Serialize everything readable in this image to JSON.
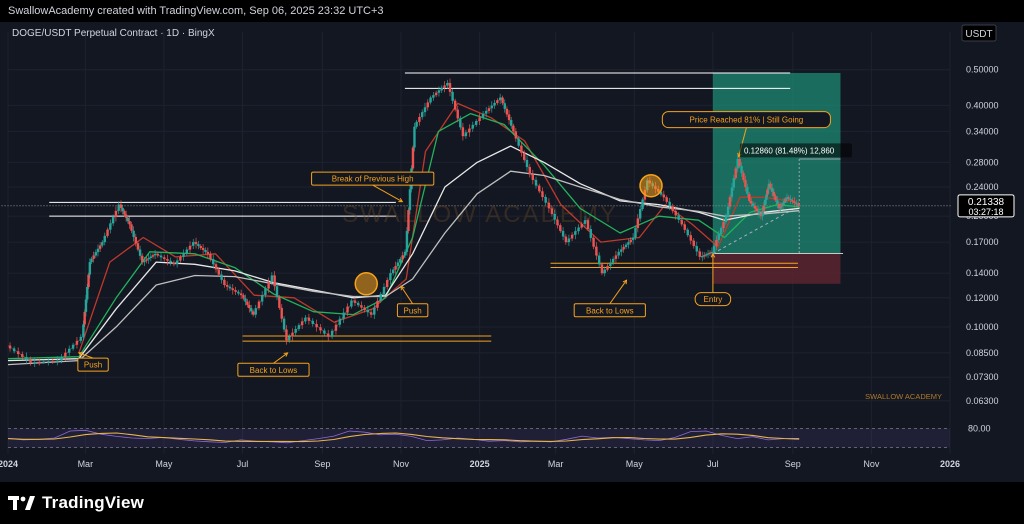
{
  "header": {
    "attribution": "SwallowAcademy created with TradingView.com, Sep 06, 2025 23:32 UTC+3"
  },
  "chart_title": "DOGE/USDT Perpetual Contract · 1D · BingX",
  "currency": "USDT",
  "watermark": "SWALLOW ACADEMY",
  "brand_tag": "SWALLOW ACADEMY",
  "footer": {
    "logo_text": "TradingView"
  },
  "colors": {
    "background": "#131722",
    "up": "#26a69a",
    "down": "#ef5350",
    "annotation": "#f7a21b",
    "profit_zone": "#1d8f76",
    "loss_zone": "#5c2530",
    "ma_fast": "#c0392b",
    "ma_mid": "#21b35a",
    "ma_slow": "#ffffff",
    "rsi": "#e8b54a",
    "rsi_band": "#7e57c2"
  },
  "chart_data": {
    "type": "line",
    "title": "DOGE/USDT Perpetual Contract · 1D · BingX",
    "yscale": "log",
    "ylim": [
      0.058,
      0.58
    ],
    "x_range": [
      "2024-01-01",
      "2026-01-01"
    ],
    "y_ticks": [
      "0.50000",
      "0.40000",
      "0.34000",
      "0.28000",
      "0.24000",
      "0.20000",
      "0.17000",
      "0.14000",
      "0.12000",
      "0.10000",
      "0.08500",
      "0.07300",
      "0.06300"
    ],
    "x_ticks": [
      {
        "label": "2024",
        "x": "2024-01-01"
      },
      {
        "label": "Mar",
        "x": "2024-03-01"
      },
      {
        "label": "May",
        "x": "2024-05-01"
      },
      {
        "label": "Jul",
        "x": "2024-07-01"
      },
      {
        "label": "Sep",
        "x": "2024-09-01"
      },
      {
        "label": "Nov",
        "x": "2024-11-01"
      },
      {
        "label": "2025",
        "x": "2025-01-01"
      },
      {
        "label": "Mar",
        "x": "2025-03-01"
      },
      {
        "label": "May",
        "x": "2025-05-01"
      },
      {
        "label": "Jul",
        "x": "2025-07-01"
      },
      {
        "label": "Sep",
        "x": "2025-09-01"
      },
      {
        "label": "Nov",
        "x": "2025-11-01"
      },
      {
        "label": "2026",
        "x": "2026-01-01"
      }
    ],
    "price_series": [
      {
        "x": "2024-01-01",
        "y": 0.089
      },
      {
        "x": "2024-01-20",
        "y": 0.08
      },
      {
        "x": "2024-02-10",
        "y": 0.081
      },
      {
        "x": "2024-02-28",
        "y": 0.094
      },
      {
        "x": "2024-03-05",
        "y": 0.15
      },
      {
        "x": "2024-03-15",
        "y": 0.17
      },
      {
        "x": "2024-03-28",
        "y": 0.215
      },
      {
        "x": "2024-04-05",
        "y": 0.19
      },
      {
        "x": "2024-04-15",
        "y": 0.15
      },
      {
        "x": "2024-04-25",
        "y": 0.158
      },
      {
        "x": "2024-05-10",
        "y": 0.148
      },
      {
        "x": "2024-05-25",
        "y": 0.17
      },
      {
        "x": "2024-06-05",
        "y": 0.158
      },
      {
        "x": "2024-06-18",
        "y": 0.13
      },
      {
        "x": "2024-07-01",
        "y": 0.122
      },
      {
        "x": "2024-07-10",
        "y": 0.108
      },
      {
        "x": "2024-07-25",
        "y": 0.138
      },
      {
        "x": "2024-08-05",
        "y": 0.092
      },
      {
        "x": "2024-08-20",
        "y": 0.106
      },
      {
        "x": "2024-09-07",
        "y": 0.094
      },
      {
        "x": "2024-09-25",
        "y": 0.118
      },
      {
        "x": "2024-10-10",
        "y": 0.108
      },
      {
        "x": "2024-10-25",
        "y": 0.14
      },
      {
        "x": "2024-11-05",
        "y": 0.16
      },
      {
        "x": "2024-11-12",
        "y": 0.35
      },
      {
        "x": "2024-11-25",
        "y": 0.42
      },
      {
        "x": "2024-12-08",
        "y": 0.46
      },
      {
        "x": "2024-12-20",
        "y": 0.33
      },
      {
        "x": "2025-01-05",
        "y": 0.38
      },
      {
        "x": "2025-01-18",
        "y": 0.42
      },
      {
        "x": "2025-01-28",
        "y": 0.34
      },
      {
        "x": "2025-02-10",
        "y": 0.26
      },
      {
        "x": "2025-02-25",
        "y": 0.21
      },
      {
        "x": "2025-03-10",
        "y": 0.17
      },
      {
        "x": "2025-03-25",
        "y": 0.195
      },
      {
        "x": "2025-04-07",
        "y": 0.14
      },
      {
        "x": "2025-04-20",
        "y": 0.16
      },
      {
        "x": "2025-05-01",
        "y": 0.175
      },
      {
        "x": "2025-05-12",
        "y": 0.25
      },
      {
        "x": "2025-05-25",
        "y": 0.225
      },
      {
        "x": "2025-06-08",
        "y": 0.19
      },
      {
        "x": "2025-06-22",
        "y": 0.155
      },
      {
        "x": "2025-07-01",
        "y": 0.16
      },
      {
        "x": "2025-07-12",
        "y": 0.2
      },
      {
        "x": "2025-07-21",
        "y": 0.286
      },
      {
        "x": "2025-07-30",
        "y": 0.22
      },
      {
        "x": "2025-08-08",
        "y": 0.2
      },
      {
        "x": "2025-08-14",
        "y": 0.245
      },
      {
        "x": "2025-08-22",
        "y": 0.21
      },
      {
        "x": "2025-08-28",
        "y": 0.225
      },
      {
        "x": "2025-09-06",
        "y": 0.2134
      }
    ],
    "moving_averages": [
      {
        "color": "#c0392b",
        "points": [
          {
            "x": "2024-02-25",
            "y": 0.085
          },
          {
            "x": "2024-03-20",
            "y": 0.15
          },
          {
            "x": "2024-04-15",
            "y": 0.175
          },
          {
            "x": "2024-05-10",
            "y": 0.155
          },
          {
            "x": "2024-06-10",
            "y": 0.158
          },
          {
            "x": "2024-07-10",
            "y": 0.122
          },
          {
            "x": "2024-08-10",
            "y": 0.12
          },
          {
            "x": "2024-09-10",
            "y": 0.103
          },
          {
            "x": "2024-10-10",
            "y": 0.112
          },
          {
            "x": "2024-11-05",
            "y": 0.135
          },
          {
            "x": "2024-11-20",
            "y": 0.3
          },
          {
            "x": "2024-12-15",
            "y": 0.405
          },
          {
            "x": "2025-01-10",
            "y": 0.37
          },
          {
            "x": "2025-02-05",
            "y": 0.32
          },
          {
            "x": "2025-03-05",
            "y": 0.215
          },
          {
            "x": "2025-04-05",
            "y": 0.17
          },
          {
            "x": "2025-05-05",
            "y": 0.175
          },
          {
            "x": "2025-05-25",
            "y": 0.215
          },
          {
            "x": "2025-06-15",
            "y": 0.19
          },
          {
            "x": "2025-07-05",
            "y": 0.165
          },
          {
            "x": "2025-07-22",
            "y": 0.225
          },
          {
            "x": "2025-08-10",
            "y": 0.225
          },
          {
            "x": "2025-09-06",
            "y": 0.218
          }
        ]
      },
      {
        "color": "#21b35a",
        "points": [
          {
            "x": "2024-01-01",
            "y": 0.082
          },
          {
            "x": "2024-02-25",
            "y": 0.083
          },
          {
            "x": "2024-03-25",
            "y": 0.12
          },
          {
            "x": "2024-04-20",
            "y": 0.16
          },
          {
            "x": "2024-05-25",
            "y": 0.158
          },
          {
            "x": "2024-06-25",
            "y": 0.145
          },
          {
            "x": "2024-07-25",
            "y": 0.123
          },
          {
            "x": "2024-08-25",
            "y": 0.11
          },
          {
            "x": "2024-09-25",
            "y": 0.108
          },
          {
            "x": "2024-10-20",
            "y": 0.12
          },
          {
            "x": "2024-11-10",
            "y": 0.175
          },
          {
            "x": "2024-11-30",
            "y": 0.34
          },
          {
            "x": "2024-12-25",
            "y": 0.38
          },
          {
            "x": "2025-01-20",
            "y": 0.355
          },
          {
            "x": "2025-02-20",
            "y": 0.275
          },
          {
            "x": "2025-03-20",
            "y": 0.21
          },
          {
            "x": "2025-04-20",
            "y": 0.18
          },
          {
            "x": "2025-05-20",
            "y": 0.2
          },
          {
            "x": "2025-06-20",
            "y": 0.195
          },
          {
            "x": "2025-07-10",
            "y": 0.175
          },
          {
            "x": "2025-07-30",
            "y": 0.205
          },
          {
            "x": "2025-08-20",
            "y": 0.215
          },
          {
            "x": "2025-09-06",
            "y": 0.212
          }
        ]
      },
      {
        "color": "#e9e9e9",
        "points": [
          {
            "x": "2024-01-01",
            "y": 0.081
          },
          {
            "x": "2024-02-25",
            "y": 0.082
          },
          {
            "x": "2024-03-25",
            "y": 0.112
          },
          {
            "x": "2024-04-25",
            "y": 0.15
          },
          {
            "x": "2024-05-25",
            "y": 0.148
          },
          {
            "x": "2024-06-25",
            "y": 0.142
          },
          {
            "x": "2024-07-25",
            "y": 0.132
          },
          {
            "x": "2024-08-25",
            "y": 0.126
          },
          {
            "x": "2024-09-25",
            "y": 0.12
          },
          {
            "x": "2024-10-20",
            "y": 0.122
          },
          {
            "x": "2024-11-10",
            "y": 0.158
          },
          {
            "x": "2024-12-05",
            "y": 0.24
          },
          {
            "x": "2024-12-30",
            "y": 0.28
          },
          {
            "x": "2025-01-25",
            "y": 0.31
          },
          {
            "x": "2025-02-20",
            "y": 0.28
          },
          {
            "x": "2025-03-20",
            "y": 0.245
          },
          {
            "x": "2025-04-20",
            "y": 0.22
          },
          {
            "x": "2025-05-20",
            "y": 0.215
          },
          {
            "x": "2025-06-20",
            "y": 0.205
          },
          {
            "x": "2025-07-10",
            "y": 0.195
          },
          {
            "x": "2025-08-10",
            "y": 0.205
          },
          {
            "x": "2025-09-06",
            "y": 0.21
          }
        ]
      },
      {
        "color": "#bfbfbf",
        "points": [
          {
            "x": "2024-01-01",
            "y": 0.079
          },
          {
            "x": "2024-02-25",
            "y": 0.081
          },
          {
            "x": "2024-03-25",
            "y": 0.1
          },
          {
            "x": "2024-04-25",
            "y": 0.13
          },
          {
            "x": "2024-05-25",
            "y": 0.138
          },
          {
            "x": "2024-06-25",
            "y": 0.137
          },
          {
            "x": "2024-07-25",
            "y": 0.131
          },
          {
            "x": "2024-08-25",
            "y": 0.125
          },
          {
            "x": "2024-09-25",
            "y": 0.121
          },
          {
            "x": "2024-10-20",
            "y": 0.121
          },
          {
            "x": "2024-11-10",
            "y": 0.135
          },
          {
            "x": "2024-12-05",
            "y": 0.18
          },
          {
            "x": "2024-12-30",
            "y": 0.23
          },
          {
            "x": "2025-01-25",
            "y": 0.265
          },
          {
            "x": "2025-02-20",
            "y": 0.258
          },
          {
            "x": "2025-03-20",
            "y": 0.24
          },
          {
            "x": "2025-04-20",
            "y": 0.222
          },
          {
            "x": "2025-05-20",
            "y": 0.212
          },
          {
            "x": "2025-06-20",
            "y": 0.206
          },
          {
            "x": "2025-07-10",
            "y": 0.2
          },
          {
            "x": "2025-08-10",
            "y": 0.203
          },
          {
            "x": "2025-09-06",
            "y": 0.207
          }
        ]
      }
    ],
    "horizontal_levels": [
      {
        "y": 0.218,
        "x1": "2024-02-02",
        "x2": "2024-10-28",
        "color": "#ffffff"
      },
      {
        "y": 0.2,
        "x1": "2024-02-02",
        "x2": "2024-10-28",
        "color": "#ffffff"
      },
      {
        "y": 0.49,
        "x1": "2024-11-04",
        "x2": "2025-08-30",
        "color": "#ffffff"
      },
      {
        "y": 0.445,
        "x1": "2024-11-04",
        "x2": "2025-08-30",
        "color": "#ffffff"
      },
      {
        "y": 0.0945,
        "x1": "2024-07-01",
        "x2": "2025-01-10",
        "color": "#f7a21b"
      },
      {
        "y": 0.0915,
        "x1": "2024-07-01",
        "x2": "2025-01-10",
        "color": "#f7a21b"
      },
      {
        "y": 0.149,
        "x1": "2025-02-25",
        "x2": "2025-09-05",
        "color": "#f7a21b"
      },
      {
        "y": 0.145,
        "x1": "2025-02-25",
        "x2": "2025-09-05",
        "color": "#f7a21b"
      },
      {
        "y": 0.2134,
        "x1": "2023-12-20",
        "x2": "2026-01-03",
        "color": "#8a8f99",
        "dotted": true
      }
    ],
    "position": {
      "x1": "2025-07-01",
      "x2": "2025-10-08",
      "entry": 0.1583,
      "target": 0.49,
      "stop": 0.131,
      "profit_color": "#1d8f76",
      "loss_color": "#5c2530"
    },
    "annotations": [
      {
        "text": "Break of Previous High",
        "x": "2024-10-10",
        "y": 0.253,
        "arrow_to": {
          "x": "2024-11-02",
          "y": 0.219
        }
      },
      {
        "text": "Push",
        "x": "2024-03-07",
        "y": 0.079,
        "arrow_to": {
          "x": "2024-02-25",
          "y": 0.085
        }
      },
      {
        "text": "Push",
        "x": "2024-11-10",
        "y": 0.111,
        "arrow_to": {
          "x": "2024-11-01",
          "y": 0.129
        }
      },
      {
        "text": "Back to Lows",
        "x": "2024-07-25",
        "y": 0.0765,
        "arrow_to": {
          "x": "2024-08-05",
          "y": 0.085
        }
      },
      {
        "text": "Back to Lows",
        "x": "2025-04-12",
        "y": 0.111,
        "arrow_to": {
          "x": "2025-04-25",
          "y": 0.134
        }
      },
      {
        "text": "Entry",
        "x": "2025-07-01",
        "y": 0.119,
        "arrow_to": {
          "x": "2025-07-01",
          "y": 0.158
        }
      },
      {
        "text": "Price Reached 81% | Still Going",
        "x": "2025-07-27",
        "y": 0.366,
        "arrow_to": {
          "x": "2025-07-21",
          "y": 0.29
        }
      }
    ],
    "circles": [
      {
        "x": "2024-10-05",
        "y": 0.131
      },
      {
        "x": "2025-05-14",
        "y": 0.242
      }
    ],
    "position_label": "0.12860 (81.48%) 12,860",
    "last_price": {
      "value": "0.21338",
      "countdown": "03:27:18"
    },
    "rsi": {
      "level_label": "80.00",
      "upper": 80,
      "lower": 20,
      "values": [
        48,
        44,
        46,
        50,
        72,
        74,
        62,
        55,
        50,
        48,
        52,
        46,
        41,
        38,
        36,
        44,
        40,
        38,
        35,
        42,
        48,
        56,
        72,
        68,
        60,
        62,
        55,
        42,
        44,
        50,
        46,
        40,
        42,
        38,
        40,
        38,
        46,
        56,
        50,
        52,
        48,
        44,
        42,
        52,
        70,
        72,
        58,
        48,
        54,
        44,
        48,
        45
      ]
    }
  }
}
